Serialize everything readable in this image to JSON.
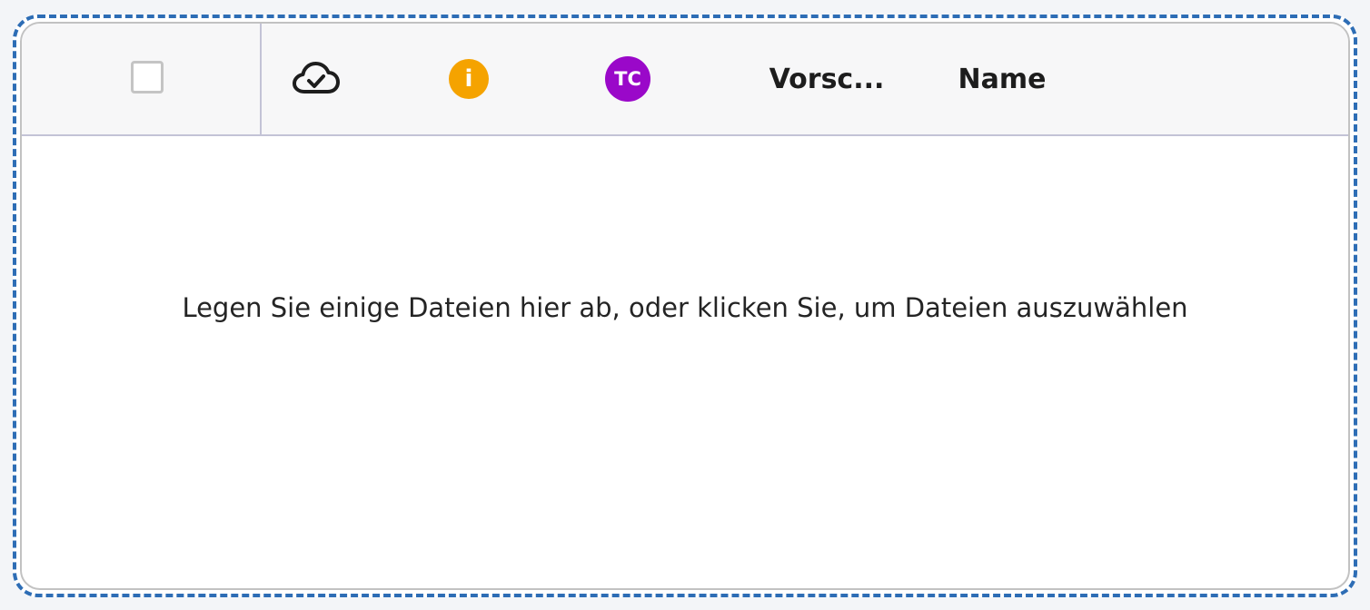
{
  "table": {
    "columns": {
      "sync_icon": "cloud-check-icon",
      "info_badge": "i",
      "info_badge_color": "#f5a300",
      "tc_badge": "TC",
      "tc_badge_color": "#9a08c9",
      "preview": "Vorsc...",
      "name": "Name"
    },
    "select_all_checked": false
  },
  "dropzone": {
    "message": "Legen Sie einige Dateien hier ab, oder klicken Sie, um Dateien auszuwählen",
    "border_color": "#2d6db5"
  }
}
